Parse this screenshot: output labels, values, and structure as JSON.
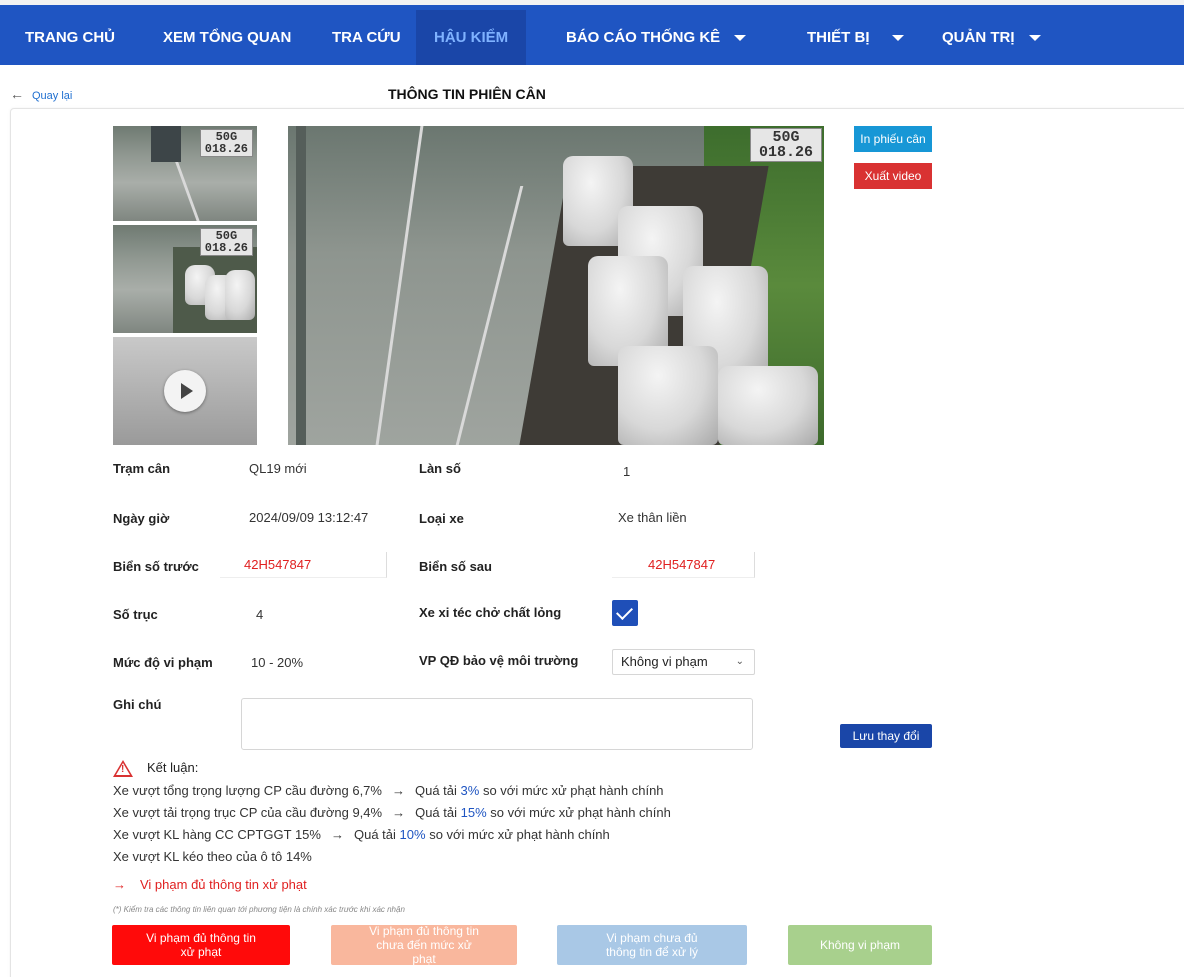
{
  "nav": {
    "items": [
      {
        "label": "TRANG CHỦ",
        "dropdown": false,
        "active": false
      },
      {
        "label": "XEM TỔNG QUAN",
        "dropdown": false,
        "active": false
      },
      {
        "label": "TRA CỨU",
        "dropdown": false,
        "active": false
      },
      {
        "label": "HẬU KIỂM",
        "dropdown": false,
        "active": true
      },
      {
        "label": "BÁO CÁO THỐNG KÊ",
        "dropdown": true,
        "active": false
      },
      {
        "label": "THIẾT BỊ",
        "dropdown": true,
        "active": false
      },
      {
        "label": "QUẢN TRỊ",
        "dropdown": true,
        "active": false
      }
    ]
  },
  "header": {
    "back_label": "Quay lại",
    "title": "THÔNG TIN PHIÊN CÂN"
  },
  "images": {
    "plate_top": "50G",
    "plate_bottom": "018.26"
  },
  "actions": {
    "print_label": "In phiếu cân",
    "export_video_label": "Xuất video",
    "save_label": "Lưu thay đổi"
  },
  "fields": {
    "station_label": "Trạm cân",
    "station_value": "QL19 mới",
    "lane_label": "Làn số",
    "lane_value": "1",
    "datetime_label": "Ngày giờ",
    "datetime_value": "2024/09/09 13:12:47",
    "vehicle_type_label": "Loại xe",
    "vehicle_type_value": "Xe thân liền",
    "front_plate_label": "Biển số trước",
    "front_plate_value": "42H547847",
    "rear_plate_label": "Biển số sau",
    "rear_plate_value": "42H547847",
    "axles_label": "Số trục",
    "axles_value": "4",
    "tanker_label": "Xe xi téc chở chất lỏng",
    "tanker_checked": true,
    "violation_level_label": "Mức độ vi phạm",
    "violation_level_value": "10 - 20%",
    "env_label": "VP QĐ bảo vệ môi trường",
    "env_value": "Không vi phạm",
    "note_label": "Ghi chú",
    "note_value": ""
  },
  "conclusion": {
    "title": "Kết luận:",
    "lines": [
      {
        "text": "Xe vượt tổng trọng lượng CP cầu đường 6,7%",
        "result_prefix": "Quá tải",
        "pct": "3%",
        "result_suffix": "so với mức xử phạt hành chính"
      },
      {
        "text": "Xe vượt tải trọng trục CP của cầu đường 9,4%",
        "result_prefix": "Quá tải",
        "pct": "15%",
        "result_suffix": "so với mức xử phạt hành chính"
      },
      {
        "text": "Xe vượt KL hàng CC CPTGGT 15%",
        "result_prefix": "Quá tải",
        "pct": "10%",
        "result_suffix": "so với mức xử phạt hành chính"
      },
      {
        "text": "Xe vượt KL kéo theo của ô tô 14%"
      }
    ],
    "arrow": "→",
    "verdict": "Vi phạm đủ thông tin xử phạt",
    "note": "(*) Kiểm tra các thông tin liên quan tới phương tiện là chính xác trước khi xác nhận"
  },
  "decision_buttons": [
    {
      "label": "Vi phạm đủ thông tin xử phạt",
      "color": "#ff0a0a"
    },
    {
      "label": "Vi phạm đủ thông tin chưa đến mức xử phạt",
      "color": "#f9b79d"
    },
    {
      "label": "Vi phạm chưa đủ thông tin để xử lý",
      "color": "#a9c8e6"
    },
    {
      "label": "Không vi phạm",
      "color": "#a8d08d"
    }
  ]
}
